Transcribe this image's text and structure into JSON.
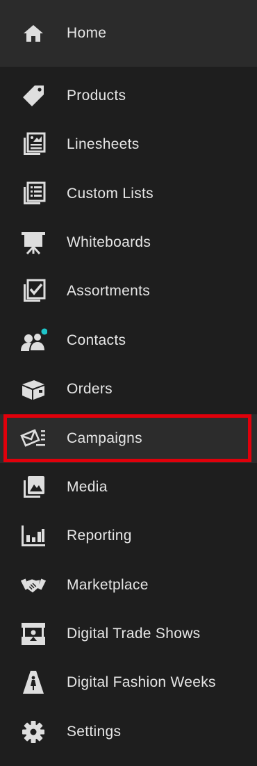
{
  "nav": {
    "home": {
      "label": "Home",
      "icon": "home-icon"
    },
    "items": [
      {
        "label": "Products",
        "icon": "tag-icon"
      },
      {
        "label": "Linesheets",
        "icon": "linesheet-icon"
      },
      {
        "label": "Custom Lists",
        "icon": "list-icon"
      },
      {
        "label": "Whiteboards",
        "icon": "whiteboard-icon"
      },
      {
        "label": "Assortments",
        "icon": "checklist-icon"
      },
      {
        "label": "Contacts",
        "icon": "contacts-icon",
        "badge_color": "#1ec5c9"
      },
      {
        "label": "Orders",
        "icon": "box-icon"
      },
      {
        "label": "Campaigns",
        "icon": "email-campaign-icon",
        "selected": true
      },
      {
        "label": "Media",
        "icon": "media-icon"
      },
      {
        "label": "Reporting",
        "icon": "bar-chart-icon"
      },
      {
        "label": "Marketplace",
        "icon": "handshake-icon"
      },
      {
        "label": "Digital Trade Shows",
        "icon": "booth-icon"
      },
      {
        "label": "Digital Fashion Weeks",
        "icon": "runway-icon"
      },
      {
        "label": "Settings",
        "icon": "gear-icon"
      }
    ]
  },
  "colors": {
    "background": "#1e1e1e",
    "home_background": "#2b2b2b",
    "icon": "#dedede",
    "highlight_border": "#e0000b",
    "badge": "#1ec5c9"
  }
}
